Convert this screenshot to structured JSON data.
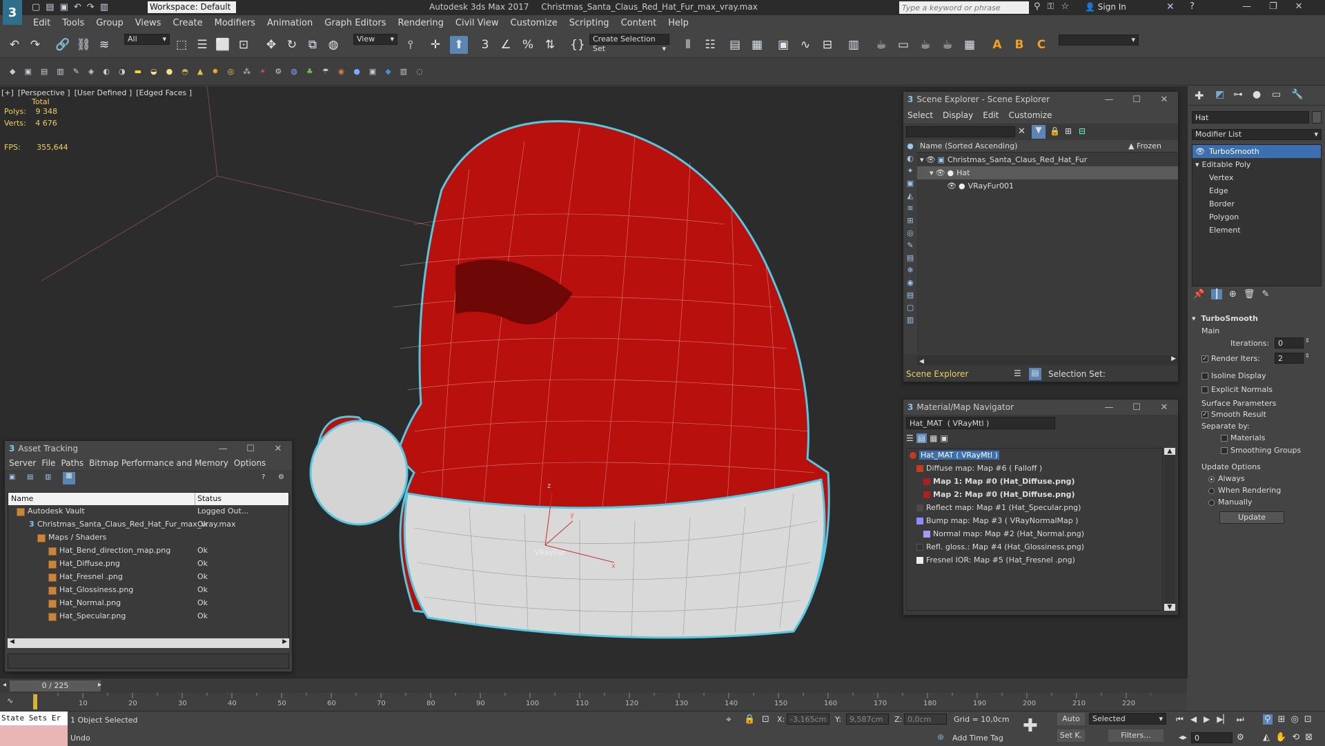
{
  "app": {
    "title": "Autodesk 3ds Max 2017",
    "file": "Christmas_Santa_Claus_Red_Hat_Fur_max_vray.max",
    "workspace": "Workspace: Default",
    "search_placeholder": "Type a keyword or phrase",
    "sign_in": "Sign In",
    "logo": "3"
  },
  "menu": [
    "Edit",
    "Tools",
    "Group",
    "Views",
    "Create",
    "Modifiers",
    "Animation",
    "Graph Editors",
    "Rendering",
    "Civil View",
    "Customize",
    "Scripting",
    "Content",
    "Help"
  ],
  "toolbar": {
    "filter_all": "All",
    "view_dropdown": "View",
    "selection_set": "Create Selection Set",
    "angle_snap": "3",
    "render_letters": [
      "A",
      "B",
      "C"
    ]
  },
  "viewport": {
    "label_plus": "[+]",
    "label_view": "[Perspective ]",
    "label_shading": "[User Defined ]",
    "label_edges": "[Edged Faces ]",
    "stats_total": "Total",
    "polys_label": "Polys:",
    "polys_value": "9 348",
    "verts_label": "Verts:",
    "verts_value": "4 676",
    "fps_label": "FPS:",
    "fps_value": "355,644",
    "gizmo_label": "VRayFur",
    "axis_x": "x",
    "axis_y": "y",
    "axis_z": "z"
  },
  "scene_explorer": {
    "title": "Scene Explorer - Scene Explorer",
    "menu": [
      "Select",
      "Display",
      "Edit",
      "Customize"
    ],
    "col_name": "Name (Sorted Ascending)",
    "col_frozen": "▲ Frozen",
    "rows": [
      {
        "name": "Christmas_Santa_Claus_Red_Hat_Fur",
        "indent": 0,
        "selected": false
      },
      {
        "name": "Hat",
        "indent": 1,
        "selected": true
      },
      {
        "name": "VRayFur001",
        "indent": 2,
        "selected": false
      }
    ],
    "footer_label": "Scene Explorer",
    "selection_set": "Selection Set:"
  },
  "material_nav": {
    "title": "Material/Map Navigator",
    "material_field": "Hat_MAT  ( VRayMtl )",
    "items": [
      {
        "text": "Hat_MAT  ( VRayMtl )",
        "bold": false,
        "selected": true,
        "indent": 0,
        "color": "#c23b22"
      },
      {
        "text": "Diffuse map: Map #6  ( Falloff )",
        "bold": false,
        "selected": false,
        "indent": 1,
        "color": "#c23b22"
      },
      {
        "text": "Map 1: Map #0 (Hat_Diffuse.png)",
        "bold": true,
        "selected": false,
        "indent": 2,
        "color": "#b01f1f"
      },
      {
        "text": "Map 2: Map #0 (Hat_Diffuse.png)",
        "bold": true,
        "selected": false,
        "indent": 2,
        "color": "#b01f1f"
      },
      {
        "text": "Reflect map: Map #1 (Hat_Specular.png)",
        "bold": false,
        "selected": false,
        "indent": 1,
        "color": "#4a4a4a"
      },
      {
        "text": "Bump map: Map #3  ( VRayNormalMap )",
        "bold": false,
        "selected": false,
        "indent": 1,
        "color": "#8c8cff"
      },
      {
        "text": "Normal map: Map #2 (Hat_Normal.png)",
        "bold": false,
        "selected": false,
        "indent": 2,
        "color": "#9e9ef0"
      },
      {
        "text": "Refl. gloss.: Map #4 (Hat_Glossiness.png)",
        "bold": false,
        "selected": false,
        "indent": 1,
        "color": "#333333"
      },
      {
        "text": "Fresnel IOR: Map #5 (Hat_Fresnel .png)",
        "bold": false,
        "selected": false,
        "indent": 1,
        "color": "#eeeeee"
      }
    ]
  },
  "asset_tracking": {
    "title": "Asset Tracking",
    "menu": [
      "Server",
      "File",
      "Paths",
      "Bitmap Performance and Memory",
      "Options"
    ],
    "col_name": "Name",
    "col_status": "Status",
    "rows": [
      {
        "name": "Autodesk Vault",
        "status": "Logged Out...",
        "indent": 0,
        "icon": "vault"
      },
      {
        "name": "Christmas_Santa_Claus_Red_Hat_Fur_max_vray.max",
        "status": "Ok",
        "indent": 1,
        "icon": "max"
      },
      {
        "name": "Maps / Shaders",
        "status": "",
        "indent": 2,
        "icon": "folder"
      },
      {
        "name": "Hat_Bend_direction_map.png",
        "status": "Ok",
        "indent": 3,
        "icon": "image"
      },
      {
        "name": "Hat_Diffuse.png",
        "status": "Ok",
        "indent": 3,
        "icon": "image"
      },
      {
        "name": "Hat_Fresnel .png",
        "status": "Ok",
        "indent": 3,
        "icon": "image"
      },
      {
        "name": "Hat_Glossiness.png",
        "status": "Ok",
        "indent": 3,
        "icon": "image"
      },
      {
        "name": "Hat_Normal.png",
        "status": "Ok",
        "indent": 3,
        "icon": "image"
      },
      {
        "name": "Hat_Specular.png",
        "status": "Ok",
        "indent": 3,
        "icon": "image"
      }
    ]
  },
  "command_panel": {
    "object_name": "Hat",
    "modifier_list": "Modifier List",
    "stack": [
      {
        "text": "TurboSmooth",
        "selected": true,
        "sub": false
      },
      {
        "text": "Editable Poly",
        "selected": false,
        "sub": false
      },
      {
        "text": "Vertex",
        "selected": false,
        "sub": true
      },
      {
        "text": "Edge",
        "selected": false,
        "sub": true
      },
      {
        "text": "Border",
        "selected": false,
        "sub": true
      },
      {
        "text": "Polygon",
        "selected": false,
        "sub": true
      },
      {
        "text": "Element",
        "selected": false,
        "sub": true
      }
    ],
    "rollout_title": "TurboSmooth",
    "main_label": "Main",
    "iterations_label": "Iterations:",
    "iterations_value": "0",
    "render_iters_label": "Render Iters:",
    "render_iters_value": "2",
    "isoline": "Isoline Display",
    "explicit_normals": "Explicit Normals",
    "surface_params": "Surface Parameters",
    "smooth_result": "Smooth Result",
    "separate_by": "Separate by:",
    "materials": "Materials",
    "smoothing_groups": "Smoothing Groups",
    "update_options": "Update Options",
    "always": "Always",
    "when_rendering": "When Rendering",
    "manually": "Manually",
    "update_btn": "Update"
  },
  "timeline": {
    "frame_counter": "0 / 225",
    "ticks": [
      "10",
      "20",
      "30",
      "40",
      "50",
      "60",
      "70",
      "80",
      "90",
      "100",
      "110",
      "120",
      "130",
      "140",
      "150",
      "160",
      "170",
      "180",
      "190",
      "200",
      "210",
      "220"
    ]
  },
  "status": {
    "state_sets": "State Sets Er",
    "objects_selected": "1 Object Selected",
    "undo": "Undo",
    "x_label": "X:",
    "x_value": "-3,165cm",
    "y_label": "Y:",
    "y_value": "9,587cm",
    "z_label": "Z:",
    "z_value": "0,0cm",
    "grid": "Grid = 10,0cm",
    "add_time_tag": "Add Time Tag",
    "auto": "Auto",
    "set_key": "Set K.",
    "selected_dropdown": "Selected",
    "filters": "Filters...",
    "frame_value": "0"
  },
  "colors": {
    "accent": "#5b86b3",
    "selection": "#55c8e0",
    "hat_red": "#b8100c",
    "fur_white": "#d9d9d9"
  }
}
